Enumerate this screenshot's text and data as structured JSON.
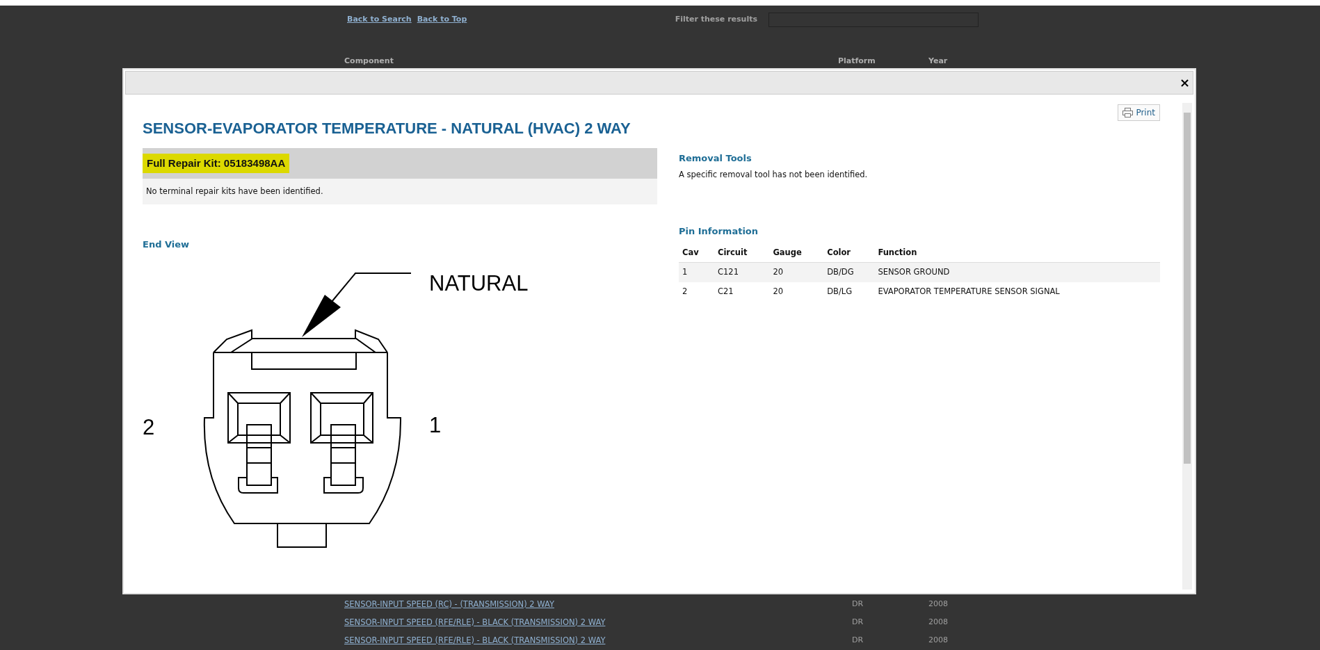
{
  "page": {
    "links": [
      "Back to Search",
      "Back to Top"
    ],
    "filter": {
      "label": "Filter these results"
    },
    "columns": [
      "Component",
      "Platform",
      "Year"
    ],
    "rows": [
      {
        "component": "SENSOR-INPUT SPEED (RC) - (TRANSMISSION) 2 WAY",
        "platform": "DR",
        "year": "2008"
      },
      {
        "component": "SENSOR-INPUT SPEED (RFE/RLE) - BLACK (TRANSMISSION) 2 WAY",
        "platform": "DR",
        "year": "2008"
      },
      {
        "component": "SENSOR-INPUT SPEED (RFE/RLE) - BLACK (TRANSMISSION) 2 WAY",
        "platform": "DR",
        "year": "2008"
      }
    ]
  },
  "modal": {
    "close": "×",
    "print": "Print",
    "title": "SENSOR-EVAPORATOR TEMPERATURE - NATURAL (HVAC) 2 WAY",
    "repair_kit": {
      "title": "Full Repair Kit: 05183498AA",
      "highlighted": true,
      "note": "No terminal repair kits have been identified."
    },
    "end_view": {
      "heading": "End View",
      "callout": "NATURAL",
      "pin_labels": [
        "2",
        "1"
      ]
    },
    "removal_tools": {
      "heading": "Removal Tools",
      "text": "A specific removal tool has not been identified."
    },
    "pin_info": {
      "heading": "Pin Information",
      "columns": [
        "Cav",
        "Circuit",
        "Gauge",
        "Color",
        "Function"
      ],
      "rows": [
        [
          "1",
          "C121",
          "20",
          "DB/DG",
          "SENSOR GROUND"
        ],
        [
          "2",
          "C21",
          "20",
          "DB/LG",
          "EVAPORATOR TEMPERATURE SENSOR SIGNAL"
        ]
      ]
    }
  }
}
